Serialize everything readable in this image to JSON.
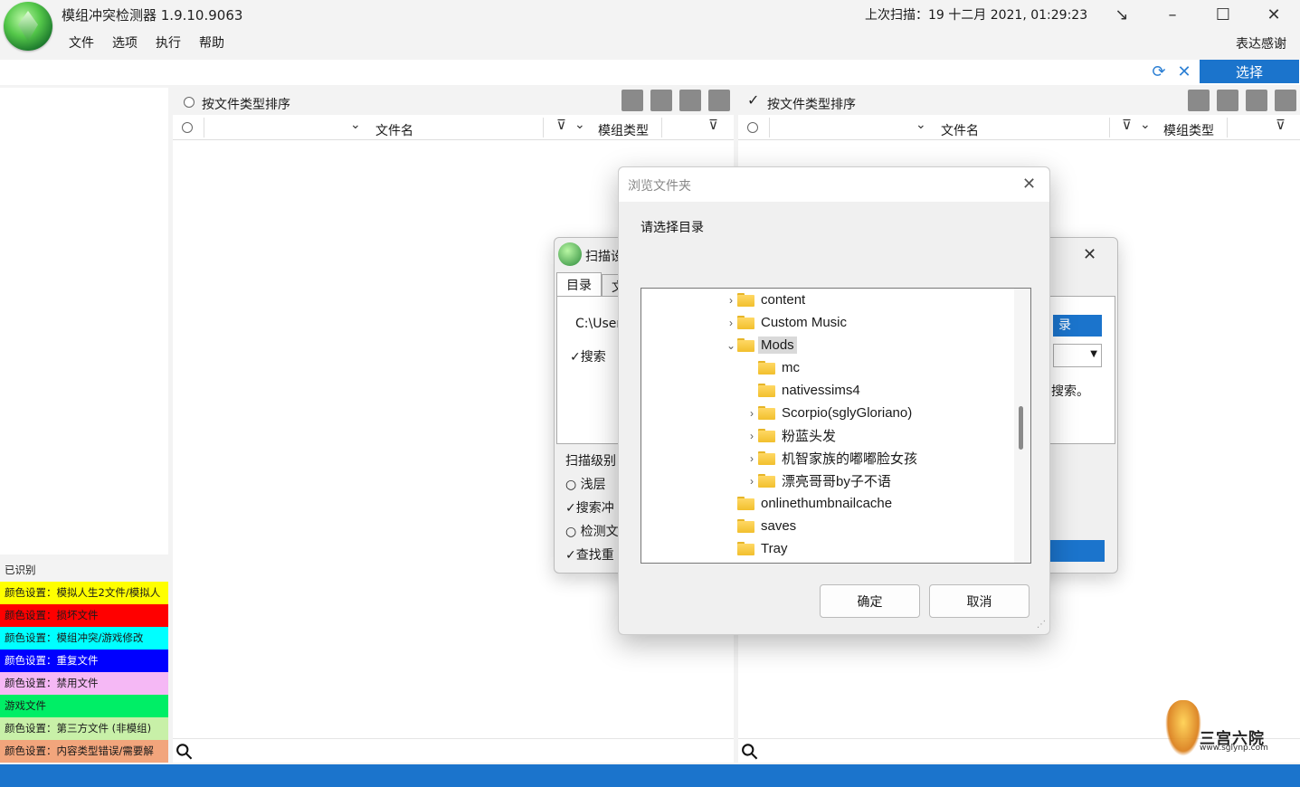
{
  "app": {
    "title": "模组冲突检测器 1.9.10.9063",
    "last_scan": "上次扫描：19 十二月 2021, 01:29:23",
    "thanks": "表达感谢",
    "menu": [
      "文件",
      "选项",
      "执行",
      "帮助"
    ],
    "window_controls": {
      "restore": "↘",
      "minimize": "–",
      "maximize": "☐",
      "close": "✕"
    }
  },
  "toolbar": {
    "refresh_icon": "⟳",
    "clear_icon": "✕",
    "select_label": "选择"
  },
  "sidebar": {
    "recognized_label": "已识别",
    "legend": [
      {
        "label": "颜色设置：模拟人生2文件/模拟人",
        "color": "#ffff00"
      },
      {
        "label": "颜色设置：损坏文件",
        "color": "#ff0000"
      },
      {
        "label": "颜色设置：模组冲突/游戏修改",
        "color": "#00ffff"
      },
      {
        "label": "颜色设置：重复文件",
        "color": "#0000ff",
        "text_color": "#ffffff"
      },
      {
        "label": "颜色设置：禁用文件",
        "color": "#f5b8f5"
      },
      {
        "label": "游戏文件",
        "color": "#00ee66"
      },
      {
        "label": "颜色设置：第三方文件 (非模组)",
        "color": "#c8f0a8"
      },
      {
        "label": "颜色设置：内容类型错误/需要解",
        "color": "#f2a57c"
      }
    ]
  },
  "left_panel": {
    "sort_label": "按文件类型排序",
    "col_filename": "文件名",
    "col_modtype": "模组类型"
  },
  "right_panel": {
    "sort_label": "按文件类型排序",
    "col_filename": "文件名",
    "col_modtype": "模组类型"
  },
  "scan_dialog": {
    "title": "扫描设",
    "tabs": [
      "目录",
      "文"
    ],
    "path": "C:\\User",
    "search_check": "搜索",
    "dir_button": "录",
    "hint": "搜索。",
    "level_label": "扫描级别",
    "options": [
      "浅层",
      "搜索冲",
      "检测文",
      "查找重"
    ]
  },
  "browse_dialog": {
    "title": "浏览文件夹",
    "prompt": "请选择目录",
    "tree": [
      {
        "label": "content",
        "level": 0,
        "caret": "›",
        "selected": false
      },
      {
        "label": "Custom Music",
        "level": 0,
        "caret": "›",
        "selected": false
      },
      {
        "label": "Mods",
        "level": 0,
        "caret": "⌄",
        "selected": true
      },
      {
        "label": "mc",
        "level": 1,
        "caret": "",
        "selected": false
      },
      {
        "label": "nativessims4",
        "level": 1,
        "caret": "",
        "selected": false
      },
      {
        "label": "Scorpio(sglyGloriano)",
        "level": 1,
        "caret": "›",
        "selected": false
      },
      {
        "label": "粉蓝头发",
        "level": 1,
        "caret": "›",
        "selected": false
      },
      {
        "label": "机智家族的嘟嘟脸女孩",
        "level": 1,
        "caret": "›",
        "selected": false
      },
      {
        "label": "漂亮哥哥by子不语",
        "level": 1,
        "caret": "›",
        "selected": false
      },
      {
        "label": "onlinethumbnailcache",
        "level": 0,
        "caret": "",
        "selected": false
      },
      {
        "label": "saves",
        "level": 0,
        "caret": "",
        "selected": false
      },
      {
        "label": "Tray",
        "level": 0,
        "caret": "",
        "selected": false
      }
    ],
    "ok_label": "确定",
    "cancel_label": "取消"
  },
  "watermark": {
    "text": "三宫六院",
    "url": "www.sglynp.com"
  }
}
